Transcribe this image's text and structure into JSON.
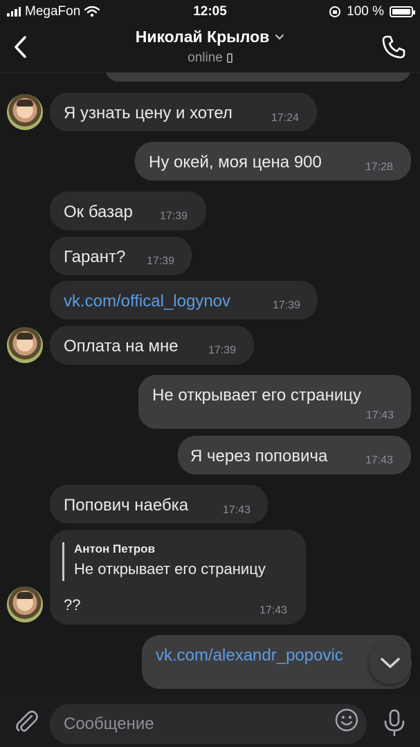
{
  "status_bar": {
    "carrier": "MegaFon",
    "time": "12:05",
    "battery_percent": "100 %",
    "battery_level": 1.0
  },
  "header": {
    "contact_name": "Николай Крылов",
    "status": "online"
  },
  "messages": [
    {
      "id": "m1",
      "direction": "in",
      "text": "Я узнать цену и хотел",
      "time": "17:24",
      "avatar": true
    },
    {
      "id": "m2",
      "direction": "out",
      "text": "Ну окей, моя цена 900",
      "time": "17:28"
    },
    {
      "id": "m3",
      "direction": "in",
      "text": "Ок базар",
      "time": "17:39"
    },
    {
      "id": "m4",
      "direction": "in",
      "text": "Гарант?",
      "time": "17:39"
    },
    {
      "id": "m5",
      "direction": "in",
      "text": "vk.com/offical_logynov",
      "time": "17:39",
      "is_link": true
    },
    {
      "id": "m6",
      "direction": "in",
      "text": "Оплата на мне",
      "time": "17:39",
      "avatar": true
    },
    {
      "id": "m7",
      "direction": "out",
      "text": "Не открывает его страницу",
      "time": "17:43"
    },
    {
      "id": "m8",
      "direction": "out",
      "text": "Я через поповича",
      "time": "17:43"
    },
    {
      "id": "m9",
      "direction": "in",
      "text": "Попович наебка",
      "time": "17:43"
    },
    {
      "id": "m10",
      "direction": "in",
      "reply_author": "Антон Петров",
      "reply_text": "Не открывает его страницу",
      "text": "??",
      "time": "17:43",
      "avatar": true
    },
    {
      "id": "m11",
      "direction": "out",
      "text": "vk.com/alexandr_popovic",
      "is_link": true
    }
  ],
  "input": {
    "placeholder": "Сообщение"
  },
  "icons": {
    "back": "chevron-left-icon",
    "call": "phone-icon",
    "attach": "paperclip-icon",
    "emoji": "smiley-icon",
    "mic": "microphone-icon",
    "scroll_down": "chevron-down-icon"
  },
  "colors": {
    "background": "#19191a",
    "incoming_bubble": "#2c2c2e",
    "outgoing_bubble": "#3d3d40",
    "link": "#5d9ce0"
  }
}
